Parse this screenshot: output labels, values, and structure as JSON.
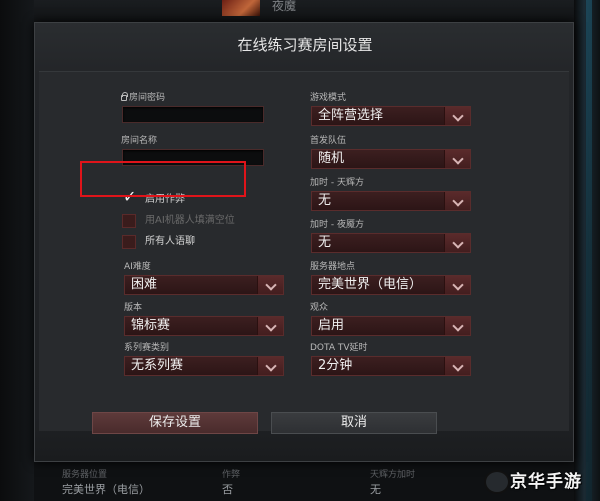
{
  "dialog": {
    "title": "在线练习赛房间设置"
  },
  "left": {
    "password_label": "房间密码",
    "room_name_label": "房间名称",
    "checkboxes": [
      {
        "label": "启用作弊",
        "checked": true
      },
      {
        "label": "用AI机器人填满空位",
        "checked": false
      },
      {
        "label": "所有人语聊",
        "checked": false
      }
    ],
    "ai_difficulty": {
      "label": "AI难度",
      "value": "困难"
    },
    "version": {
      "label": "版本",
      "value": "锦标赛"
    },
    "series": {
      "label": "系列赛类别",
      "value": "无系列赛"
    }
  },
  "right": {
    "game_mode": {
      "label": "游戏模式",
      "value": "全阵营选择"
    },
    "first_pick": {
      "label": "首发队伍",
      "value": "随机"
    },
    "bot_radiant": {
      "label": "加时 - 天辉方",
      "value": "无"
    },
    "bot_dire": {
      "label": "加时 - 夜魇方",
      "value": "无"
    },
    "server": {
      "label": "服务器地点",
      "value": "完美世界（电信）"
    },
    "spectators": {
      "label": "观众",
      "value": "启用"
    },
    "tv_delay": {
      "label": "DOTA TV延时",
      "value": "2分钟"
    }
  },
  "buttons": {
    "save": "保存设置",
    "cancel": "取消"
  },
  "background": {
    "player_name": "夜魔",
    "bottom_left_label": "服务器位置",
    "bottom_left_value": "完美世界（电信）",
    "bottom_mid_label": "作弊",
    "bottom_mid_value": "否",
    "bottom_right_label": "天辉方加时",
    "bottom_right_value": "无"
  },
  "watermark": {
    "text": "京华手游"
  },
  "colors": {
    "highlight": "#e0141a",
    "accent": "#5a2c2c"
  }
}
